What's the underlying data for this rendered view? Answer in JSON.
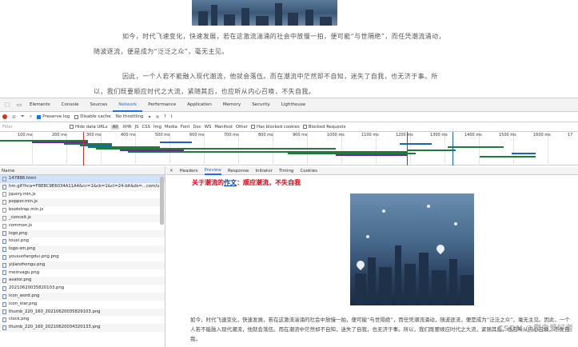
{
  "page": {
    "paragraph1": "如今，时代飞速变化，快速发展，若在这激流湍涌的社会中放慢一拍，便可能“与世隔绝”，而任凭潮流涌动，随波逐流，便是成为“泛泛之众”，毫无主见。",
    "paragraph2": "因此，一个人若不能融入现代潮流，他就会落伍。而在潮流中茫然却不自知，迷失了自我，也无济于事。所以，我们既要顺应时代之大流，紧随其后，也应听从内心召唤，不失自我。"
  },
  "devtools": {
    "panel_tabs": [
      "Elements",
      "Console",
      "Sources",
      "Network",
      "Performance",
      "Application",
      "Memory",
      "Security",
      "Lighthouse"
    ],
    "active_tab": "Network",
    "toolbar": {
      "preserve_log": "Preserve log",
      "disable_cache": "Disable cache",
      "throttling": "No throttling"
    },
    "filter": {
      "placeholder": "Filter",
      "hide_data_urls": "Hide data URLs",
      "types": [
        "All",
        "XHR",
        "JS",
        "CSS",
        "Img",
        "Media",
        "Font",
        "Doc",
        "WS",
        "Manifest",
        "Other"
      ],
      "has_blocked_cookies": "Has blocked cookies",
      "blocked_requests": "Blocked Requests"
    },
    "timeline_ticks": [
      "100 ms",
      "200 ms",
      "300 ms",
      "400 ms",
      "500 ms",
      "600 ms",
      "700 ms",
      "800 ms",
      "900 ms",
      "1000 ms",
      "1100 ms",
      "1200 ms",
      "1300 ms",
      "1400 ms",
      "1500 ms",
      "1600 ms",
      "17"
    ],
    "files_header": "Name",
    "files": [
      {
        "name": "147886.html",
        "type": "doc"
      },
      {
        "name": "hm.gif?hca=F8E8C9E6034A11A4&cc=1&ck=1&cl=24-bit&ds=...com/u",
        "type": "img"
      },
      {
        "name": "jquery.min.js",
        "type": "doc"
      },
      {
        "name": "popper.min.js",
        "type": "doc"
      },
      {
        "name": "bootstrap.min.js",
        "type": "doc"
      },
      {
        "name": "_conceit.js",
        "type": "doc"
      },
      {
        "name": "common.js",
        "type": "doc"
      },
      {
        "name": "logo.png",
        "type": "img"
      },
      {
        "name": "touxi.png",
        "type": "img"
      },
      {
        "name": "logo-sm.png",
        "type": "img"
      },
      {
        "name": "yousuofangdui.png.png",
        "type": "img"
      },
      {
        "name": "yijianzhengu.png",
        "type": "img"
      },
      {
        "name": "meinvagu.png",
        "type": "img"
      },
      {
        "name": "avator.png",
        "type": "img"
      },
      {
        "name": "20210620035820103.png",
        "type": "img"
      },
      {
        "name": "icon_word.png",
        "type": "img"
      },
      {
        "name": "icon_star.png",
        "type": "img"
      },
      {
        "name": "thumb_220_160_20210620035829103.png",
        "type": "img"
      },
      {
        "name": "clock.png",
        "type": "img"
      },
      {
        "name": "thumb_220_160_20210620034320133.png",
        "type": "img"
      }
    ],
    "detail_tabs": [
      "Headers",
      "Preview",
      "Response",
      "Initiator",
      "Timing",
      "Cookies"
    ],
    "active_detail_tab": "Preview",
    "preview": {
      "title_prefix": "关于潮流的",
      "title_link": "作文",
      "title_suffix": "：顺应潮流，不失自我",
      "body": "如今，时代飞速变化，快速发展，若在这激流湍涌的社会中放慢一拍，便可能“与世隔绝”，而任凭潮流涌动，随波逐流，便是成为“泛泛之众”，毫无主见。因此，一个人若不能融入现代潮流，他就会落伍。而在潮流中茫然却不自知，迷失了自我，也无济于事。所以，我们既要顺应时代之大流，紧随其后，也应听从内心召唤，不失自我。",
      "watermark": "CSDN @爬虫爱好者"
    },
    "colors": {
      "accent": "#1a73e8",
      "title_red": "#e60012",
      "record": "#d93025"
    }
  }
}
